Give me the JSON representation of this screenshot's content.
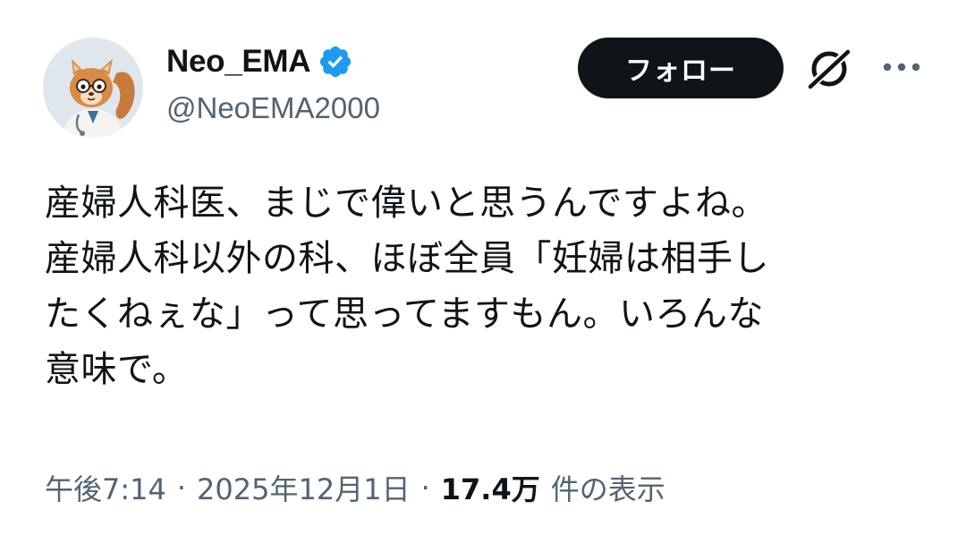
{
  "author": {
    "display_name": "Neo_EMA",
    "handle": "@NeoEMA2000",
    "verified": true,
    "avatar": "squirrel-doctor-avatar"
  },
  "actions": {
    "follow_label": "フォロー",
    "grok_icon": "grok-icon",
    "more_icon": "more-options-icon"
  },
  "tweet": {
    "lines": [
      "産婦人科医、まじで偉いと思うんですよね。",
      "産婦人科以外の科、ほぼ全員「妊婦は相手し",
      "たくねぇな」って思ってますもん。いろんな",
      "意味で。"
    ]
  },
  "meta": {
    "time": "午後7:14",
    "separator": "·",
    "date": "2025年12月1日",
    "views_count": "17.4万",
    "views_label": "件の表示"
  },
  "colors": {
    "text": "#0f1419",
    "secondary": "#536471",
    "verified_blue": "#1d9bf0",
    "follow_bg": "#0f1419"
  }
}
